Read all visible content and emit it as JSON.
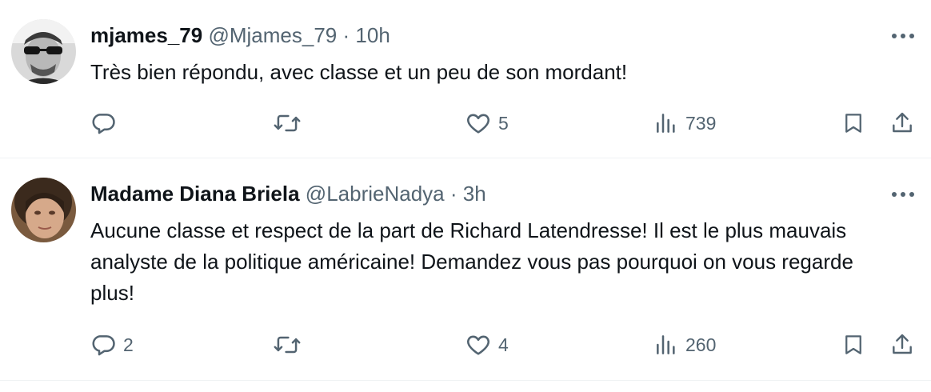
{
  "tweets": [
    {
      "display_name": "mjames_79",
      "handle": "@Mjames_79",
      "separator": "·",
      "time": "10h",
      "text": "Très bien répondu, avec classe et un peu de son mordant!",
      "replies": "",
      "retweets": "",
      "likes": "5",
      "views": "739"
    },
    {
      "display_name": "Madame Diana Briela",
      "handle": "@LabrieNadya",
      "separator": "·",
      "time": "3h",
      "text": "Aucune classe et respect de la part de Richard Latendresse! Il est le plus mauvais analyste de la politique américaine! Demandez vous pas pourquoi on vous regarde plus!",
      "replies": "2",
      "retweets": "",
      "likes": "4",
      "views": "260"
    }
  ],
  "icons": {
    "reply": "reply-icon",
    "retweet": "retweet-icon",
    "like": "heart-icon",
    "views": "views-icon",
    "bookmark": "bookmark-icon",
    "share": "share-icon",
    "more": "more-icon"
  },
  "colors": {
    "text_primary": "#0f1419",
    "text_secondary": "#536471",
    "divider": "#eff3f4"
  }
}
